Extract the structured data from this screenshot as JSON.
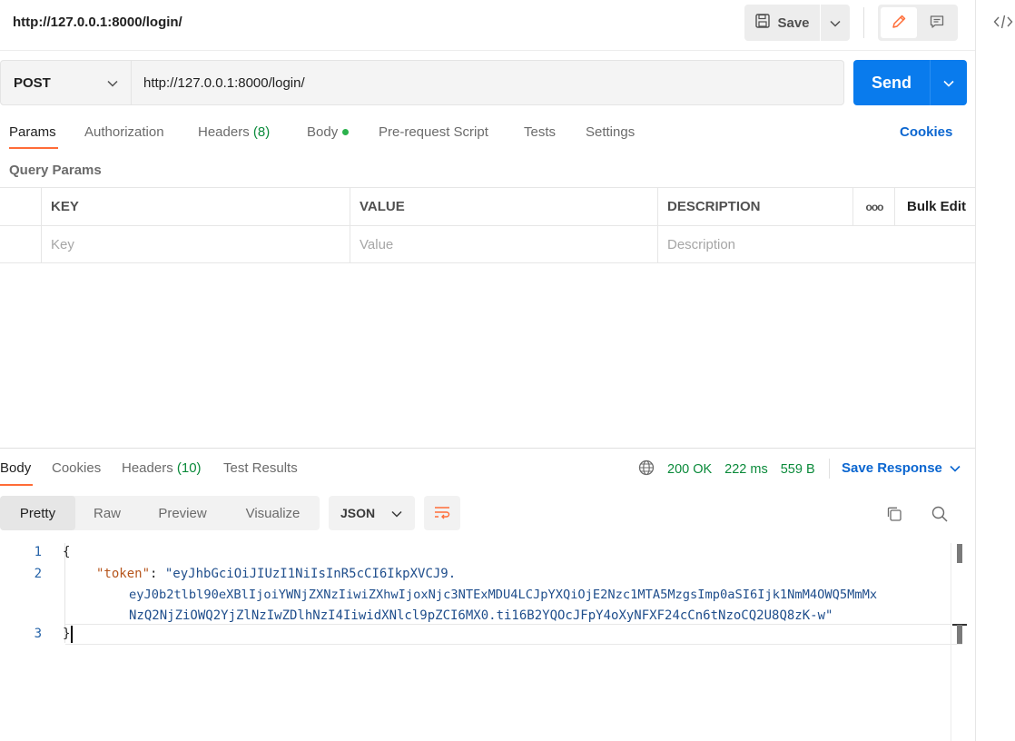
{
  "request": {
    "title": "http://127.0.0.1:8000/login/",
    "method": "POST",
    "url": "http://127.0.0.1:8000/login/",
    "save_label": "Save",
    "send_label": "Send"
  },
  "request_tabs": {
    "params": "Params",
    "authorization": "Authorization",
    "headers": "Headers",
    "headers_count": "(8)",
    "body": "Body",
    "pre_request": "Pre-request Script",
    "tests": "Tests",
    "settings": "Settings",
    "cookies": "Cookies"
  },
  "query_params": {
    "title": "Query Params",
    "columns": {
      "key": "KEY",
      "value": "VALUE",
      "description": "DESCRIPTION"
    },
    "more": "ooo",
    "bulk_edit": "Bulk Edit",
    "placeholders": {
      "key": "Key",
      "value": "Value",
      "description": "Description"
    }
  },
  "response_tabs": {
    "body": "Body",
    "cookies": "Cookies",
    "headers": "Headers",
    "headers_count": "(10)",
    "test_results": "Test Results"
  },
  "response_meta": {
    "status": "200 OK",
    "time": "222 ms",
    "size": "559 B",
    "save_response": "Save Response"
  },
  "view_modes": {
    "pretty": "Pretty",
    "raw": "Raw",
    "preview": "Preview",
    "visualize": "Visualize",
    "format": "JSON"
  },
  "response_body": {
    "line_numbers": [
      "1",
      "2",
      "3"
    ],
    "open_brace": "{",
    "close_brace": "}",
    "key": "\"token\"",
    "colon": ": ",
    "value_part1": "\"eyJhbGciOiJIUzI1NiIsInR5cCI6IkpXVCJ9.",
    "value_part2": "eyJ0b2tlbl90eXBlIjoiYWNjZXNzIiwiZXhwIjoxNjc3NTExMDU4LCJpYXQiOjE2Nzc1MTA5MzgsImp0aSI6Ijk1NmM4OWQ5MmMx",
    "value_part3": "NzQ2NjZiOWQ2YjZlNzIwZDlhNzI4IiwidXNlcl9pZCI6MX0.ti16B2YQOcJFpY4oXyNFXF24cCn6tNzoCQ2U8Q8zK-w\""
  },
  "icons": {
    "save": "floppy-disk",
    "edit": "pencil",
    "comments": "speech-bubble",
    "code": "code-brackets",
    "globe": "globe",
    "wrap": "text-wrap",
    "copy": "copy",
    "search": "magnifier"
  },
  "colors": {
    "accent": "#ff6c37",
    "send": "#097bed",
    "link": "#0b66d0",
    "success": "#0a8a3a"
  }
}
